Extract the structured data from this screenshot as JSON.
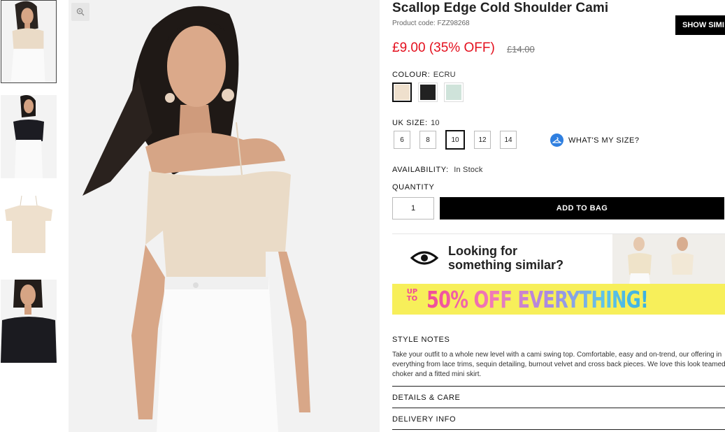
{
  "product": {
    "title": "Scallop Edge Cold Shoulder Cami",
    "code": "Product code: FZZ98268",
    "price": "£9.00 (35% OFF)",
    "old_price": "£14.00"
  },
  "colour": {
    "label": "COLOUR:",
    "value": "ECRU",
    "swatches": [
      {
        "name": "ecru",
        "color": "#efe0cd",
        "selected": true
      },
      {
        "name": "black",
        "color": "#222222",
        "selected": false
      },
      {
        "name": "mint",
        "color": "#cfe3da",
        "selected": false
      }
    ]
  },
  "size": {
    "label": "UK SIZE:",
    "value": "10",
    "options": [
      "6",
      "8",
      "10",
      "12",
      "14"
    ],
    "selected": "10",
    "whats_my_size": "WHAT'S MY SIZE?"
  },
  "availability": {
    "label": "AVAILABILITY:",
    "value": "In Stock"
  },
  "quantity": {
    "label": "QUANTITY",
    "value": "1"
  },
  "add_to_bag": "ADD TO BAG",
  "similar": {
    "line1": "Looking for",
    "line2": "something similar?",
    "button": "SHOW SIMI"
  },
  "promo": {
    "upto": "UP TO",
    "text": "50% OFF EVERYTHING!"
  },
  "style_notes": {
    "heading": "STYLE NOTES",
    "lines": [
      "Take your outfit to a whole new level with a cami swing top. Comfortable, easy and on-trend, our offering in",
      "everything from lace trims, sequin detailing, burnout velvet and cross back pieces. We love this look teamed",
      "choker and a fitted mini skirt."
    ]
  },
  "accordion": [
    "DETAILS & CARE",
    "DELIVERY INFO"
  ],
  "colors": {
    "price_red": "#e4101e",
    "accent_blue": "#2f7fe0",
    "promo_yellow": "#f7ef5a"
  }
}
